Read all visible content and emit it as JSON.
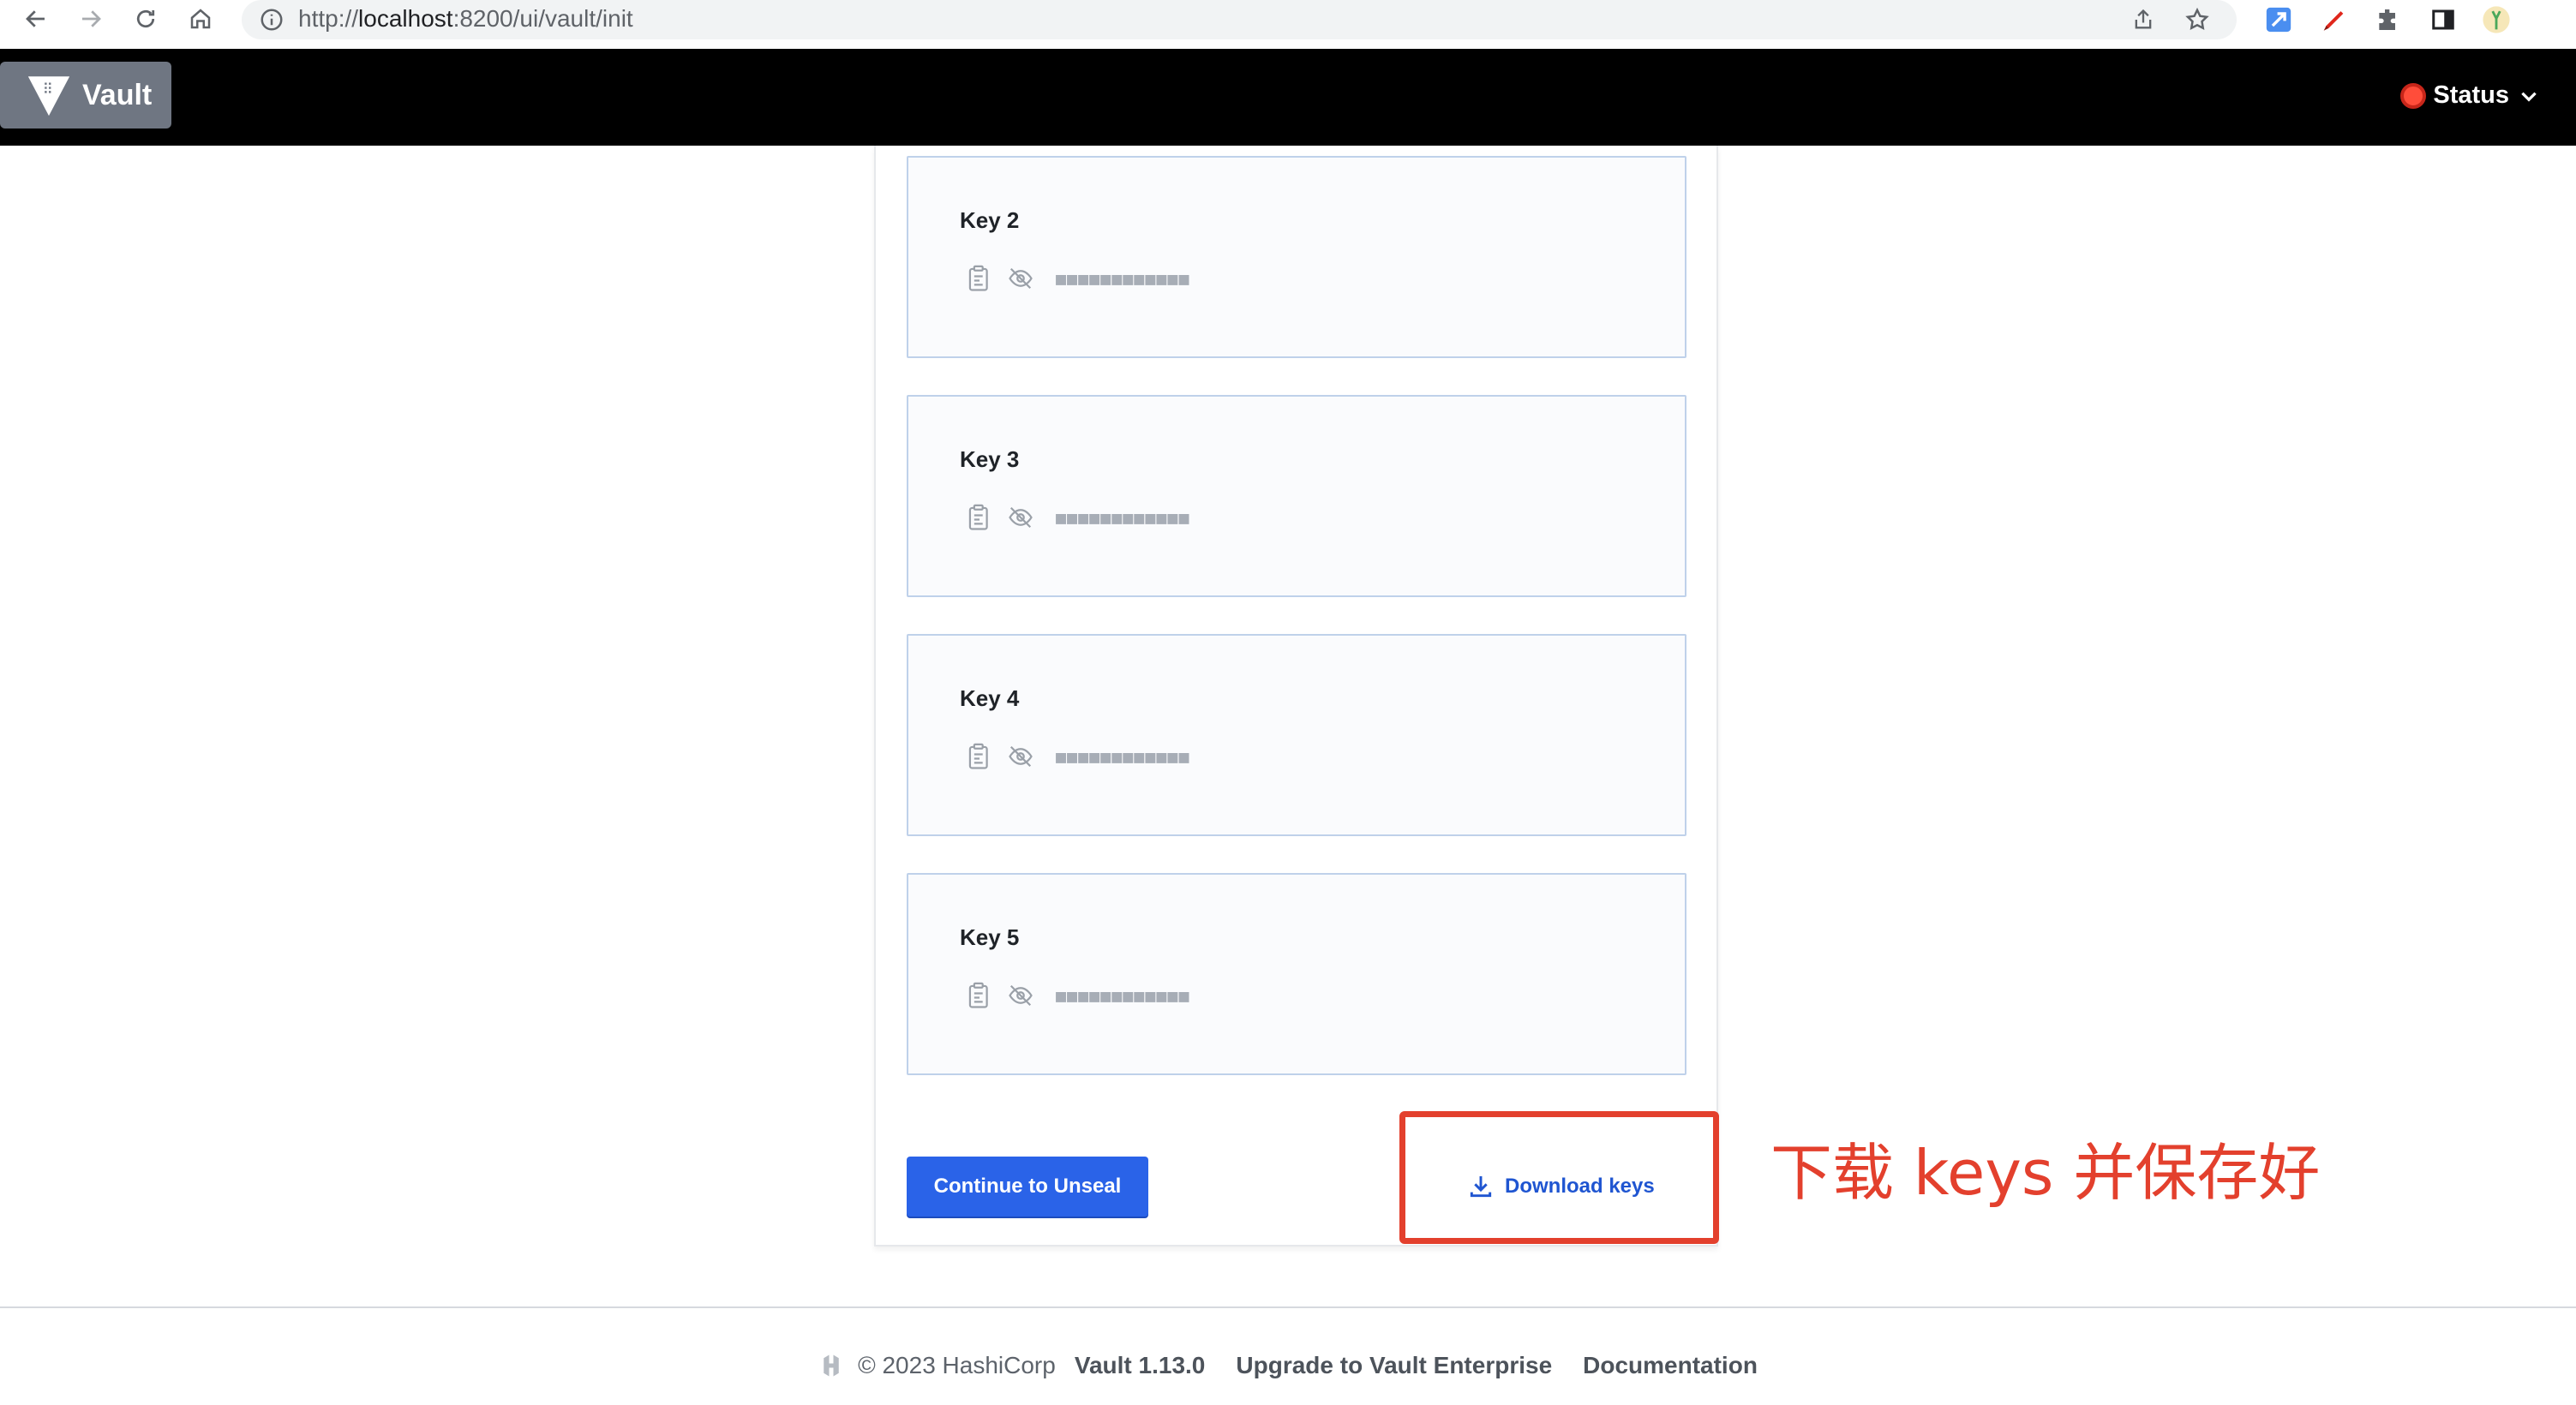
{
  "browser": {
    "url_prefix": "http://",
    "url_host": "localhost",
    "url_path": ":8200/ui/vault/init"
  },
  "header": {
    "logo_text": "Vault",
    "status_label": "Status"
  },
  "keys": [
    {
      "label": "Key 2",
      "masked": "■■■■■■■■■■■■"
    },
    {
      "label": "Key 3",
      "masked": "■■■■■■■■■■■■"
    },
    {
      "label": "Key 4",
      "masked": "■■■■■■■■■■■■"
    },
    {
      "label": "Key 5",
      "masked": "■■■■■■■■■■■■"
    }
  ],
  "actions": {
    "continue_label": "Continue to Unseal",
    "download_label": "Download keys"
  },
  "annotation": {
    "text": "下载 keys 并保存好"
  },
  "footer": {
    "copyright": "© 2023 HashiCorp",
    "version": "Vault 1.13.0",
    "upgrade": "Upgrade to Vault Enterprise",
    "docs": "Documentation"
  },
  "colors": {
    "primary": "#2a63e8",
    "annotation_red": "#e3402d",
    "status_red": "#ff4d3a"
  }
}
